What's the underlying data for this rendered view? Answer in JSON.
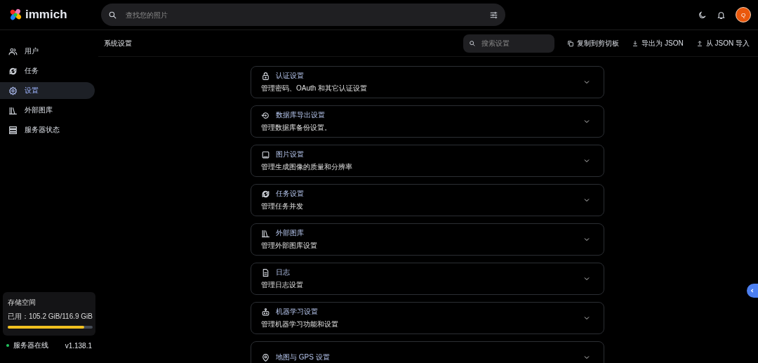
{
  "app": {
    "name": "immich"
  },
  "search": {
    "placeholder": "查找您的照片"
  },
  "user": {
    "initial": "Q"
  },
  "nav": [
    {
      "label": "用户",
      "selected": false
    },
    {
      "label": "任务",
      "selected": false
    },
    {
      "label": "设置",
      "selected": true
    },
    {
      "label": "外部图库",
      "selected": false
    },
    {
      "label": "服务器状态",
      "selected": false
    }
  ],
  "storage": {
    "title": "存储空间",
    "usage": "已用：105.2 GiB/116.9 GiB",
    "level": 0.9
  },
  "server": {
    "status": "服务器在线",
    "online": true,
    "version": "v1.138.1"
  },
  "page": {
    "title": "系统设置",
    "search_placeholder": "搜索设置",
    "actions": [
      {
        "label": "复制到剪切板"
      },
      {
        "label": "导出为 JSON"
      },
      {
        "label": "从 JSON 导入"
      }
    ]
  },
  "sections": [
    {
      "title": "认证设置",
      "description": "管理密码、OAuth 和其它认证设置",
      "expanded": false
    },
    {
      "title": "数据库导出设置",
      "description": "管理数据库备份设置。",
      "expanded": false
    },
    {
      "title": "图片设置",
      "description": "管理生成图像的质量和分辨率",
      "expanded": false
    },
    {
      "title": "任务设置",
      "description": "管理任务并发",
      "expanded": false
    },
    {
      "title": "外部图库",
      "description": "管理外部图库设置",
      "expanded": false
    },
    {
      "title": "日志",
      "description": "管理日志设置",
      "expanded": false
    },
    {
      "title": "机器学习设置",
      "description": "管理机器学习功能和设置",
      "expanded": false
    },
    {
      "title": "地图与 GPS 设置",
      "expanded": false
    }
  ]
}
